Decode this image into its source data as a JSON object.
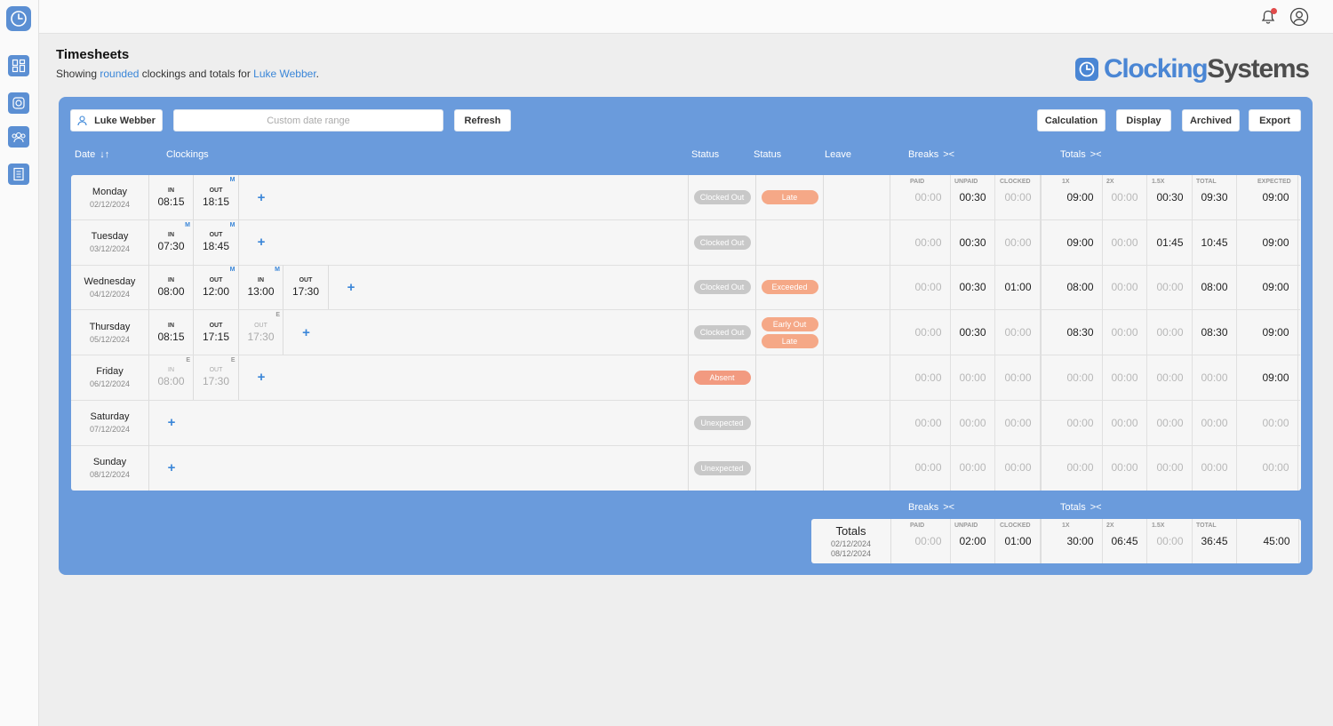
{
  "header": {
    "title": "Timesheets",
    "subtitle_pre": "Showing ",
    "subtitle_link1": "rounded",
    "subtitle_mid": " clockings and totals for ",
    "subtitle_link2": "Luke Webber",
    "subtitle_post": "."
  },
  "brand": {
    "part1": "Clocking",
    "part2": "Systems",
    "color_blue": "#4a86d4",
    "color_grey": "#4d4d4d"
  },
  "sidebar": {
    "items": [
      "logo-clock-icon",
      "dashboard-icon",
      "camera-icon",
      "users-icon",
      "reports-icon"
    ]
  },
  "topbar": {
    "notifications_icon": "bell-icon",
    "account_icon": "user-circle-icon"
  },
  "toolbar": {
    "employee_label": "Luke Webber",
    "date_placeholder": "Custom date range",
    "refresh_label": "Refresh",
    "calculation_label": "Calculation",
    "display_label": "Display",
    "archived_label": "Archived",
    "export_label": "Export"
  },
  "columns": {
    "date": "Date",
    "sort_arrows": "↓↑",
    "clockings": "Clockings",
    "status1": "Status",
    "status2": "Status",
    "leave": "Leave",
    "breaks": "Breaks",
    "totals": "Totals",
    "collapse": "><"
  },
  "labels": {
    "in": "IN",
    "out": "OUT",
    "paid": "PAID",
    "unpaid": "UNPAID",
    "clocked": "CLOCKED",
    "x1": "1X",
    "x2": "2X",
    "x15": "1.5X",
    "total": "TOTAL",
    "expected": "EXPECTED",
    "add": "+"
  },
  "rows": [
    {
      "day": "Monday",
      "date": "02/12/2024",
      "clockings": [
        {
          "type": "in",
          "time": "08:15",
          "flag": ""
        },
        {
          "type": "out",
          "time": "18:15",
          "flag": "M"
        }
      ],
      "status1": [
        "Clocked Out"
      ],
      "status2": [
        "Late"
      ],
      "breaks": [
        "00:00",
        "00:30",
        "00:00"
      ],
      "totals": [
        "09:00",
        "00:00",
        "00:30",
        "09:30"
      ],
      "expected": "09:00"
    },
    {
      "day": "Tuesday",
      "date": "03/12/2024",
      "clockings": [
        {
          "type": "in",
          "time": "07:30",
          "flag": "M"
        },
        {
          "type": "out",
          "time": "18:45",
          "flag": "M"
        }
      ],
      "status1": [
        "Clocked Out"
      ],
      "status2": [],
      "breaks": [
        "00:00",
        "00:30",
        "00:00"
      ],
      "totals": [
        "09:00",
        "00:00",
        "01:45",
        "10:45"
      ],
      "expected": "09:00"
    },
    {
      "day": "Wednesday",
      "date": "04/12/2024",
      "clockings": [
        {
          "type": "in",
          "time": "08:00",
          "flag": ""
        },
        {
          "type": "out",
          "time": "12:00",
          "flag": "M"
        },
        {
          "type": "in",
          "time": "13:00",
          "flag": "M"
        },
        {
          "type": "out",
          "time": "17:30",
          "flag": ""
        }
      ],
      "status1": [
        "Clocked Out"
      ],
      "status2": [
        "Exceeded"
      ],
      "breaks": [
        "00:00",
        "00:30",
        "01:00"
      ],
      "totals": [
        "08:00",
        "00:00",
        "00:00",
        "08:00"
      ],
      "expected": "09:00"
    },
    {
      "day": "Thursday",
      "date": "05/12/2024",
      "clockings": [
        {
          "type": "in",
          "time": "08:15",
          "flag": ""
        },
        {
          "type": "out",
          "time": "17:15",
          "flag": ""
        },
        {
          "type": "out",
          "time": "17:30",
          "flag": "E",
          "expected": true
        }
      ],
      "status1": [
        "Clocked Out"
      ],
      "status2": [
        "Early Out",
        "Late"
      ],
      "breaks": [
        "00:00",
        "00:30",
        "00:00"
      ],
      "totals": [
        "08:30",
        "00:00",
        "00:00",
        "08:30"
      ],
      "expected": "09:00"
    },
    {
      "day": "Friday",
      "date": "06/12/2024",
      "clockings": [
        {
          "type": "in",
          "time": "08:00",
          "flag": "E",
          "expected": true
        },
        {
          "type": "out",
          "time": "17:30",
          "flag": "E",
          "expected": true
        }
      ],
      "status1": [
        "Absent"
      ],
      "status2": [],
      "breaks": [
        "00:00",
        "00:00",
        "00:00"
      ],
      "totals": [
        "00:00",
        "00:00",
        "00:00",
        "00:00"
      ],
      "expected": "09:00"
    },
    {
      "day": "Saturday",
      "date": "07/12/2024",
      "clockings": [],
      "status1": [
        "Unexpected"
      ],
      "status2": [],
      "breaks": [
        "00:00",
        "00:00",
        "00:00"
      ],
      "totals": [
        "00:00",
        "00:00",
        "00:00",
        "00:00"
      ],
      "expected": "00:00"
    },
    {
      "day": "Sunday",
      "date": "08/12/2024",
      "clockings": [],
      "status1": [
        "Unexpected"
      ],
      "status2": [],
      "breaks": [
        "00:00",
        "00:00",
        "00:00"
      ],
      "totals": [
        "00:00",
        "00:00",
        "00:00",
        "00:00"
      ],
      "expected": "00:00"
    }
  ],
  "summary": {
    "title": "Totals",
    "from": "02/12/2024",
    "to": "08/12/2024",
    "breaks": [
      "00:00",
      "02:00",
      "01:00"
    ],
    "totals": [
      "30:00",
      "06:45",
      "00:00",
      "36:45"
    ],
    "expected": "45:00"
  },
  "colors": {
    "panel": "#6a9bdc",
    "pill_grey": "#c8c8c8",
    "pill_orange": "#f5a887",
    "pill_absent": "#f29a80",
    "link": "#3a86d8"
  }
}
